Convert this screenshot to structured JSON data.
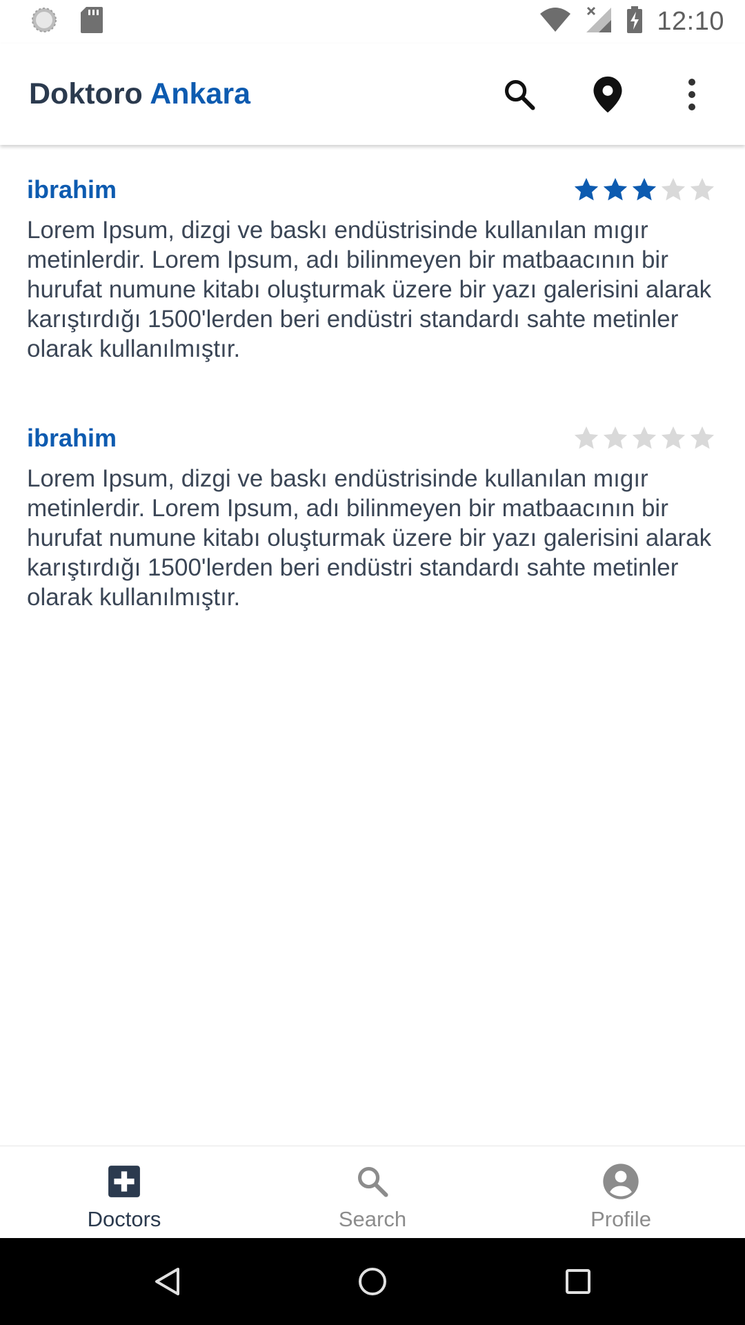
{
  "status_bar": {
    "time": "12:10",
    "icons": [
      "sync-icon",
      "sd-card-icon",
      "wifi-icon",
      "no-signal-icon",
      "battery-charging-icon"
    ]
  },
  "app_bar": {
    "title_part1": "Doktoro",
    "title_part2": "Ankara",
    "actions": [
      "search-icon",
      "location-pin-icon",
      "more-vert-icon"
    ]
  },
  "reviews": [
    {
      "name": "ibrahim",
      "rating": 3,
      "max_rating": 5,
      "text": "Lorem Ipsum, dizgi ve baskı endüstrisinde kullanılan mıgır metinlerdir. Lorem Ipsum, adı bilinmeyen bir matbaacının bir hurufat numune kitabı oluşturmak üzere bir yazı galerisini alarak karıştırdığı 1500'lerden beri endüstri standardı sahte metinler olarak kullanılmıştır."
    },
    {
      "name": "ibrahim",
      "rating": 0,
      "max_rating": 5,
      "text": "Lorem Ipsum, dizgi ve baskı endüstrisinde kullanılan mıgır metinlerdir. Lorem Ipsum, adı bilinmeyen bir matbaacının bir hurufat numune kitabı oluşturmak üzere bir yazı galerisini alarak karıştırdığı 1500'lerden beri endüstri standardı sahte metinler olarak kullanılmıştır."
    }
  ],
  "bottom_nav": {
    "items": [
      {
        "label": "Doctors",
        "icon": "medical-cross-icon",
        "active": true
      },
      {
        "label": "Search",
        "icon": "search-icon",
        "active": false
      },
      {
        "label": "Profile",
        "icon": "account-circle-icon",
        "active": false
      }
    ]
  },
  "colors": {
    "accent": "#0d5bb0",
    "title_dark": "#2b3a4e",
    "body_text": "#3b4656",
    "star_filled": "#0d5bb0",
    "star_empty": "#d9d9d9",
    "nav_inactive": "#8c8c8c"
  }
}
